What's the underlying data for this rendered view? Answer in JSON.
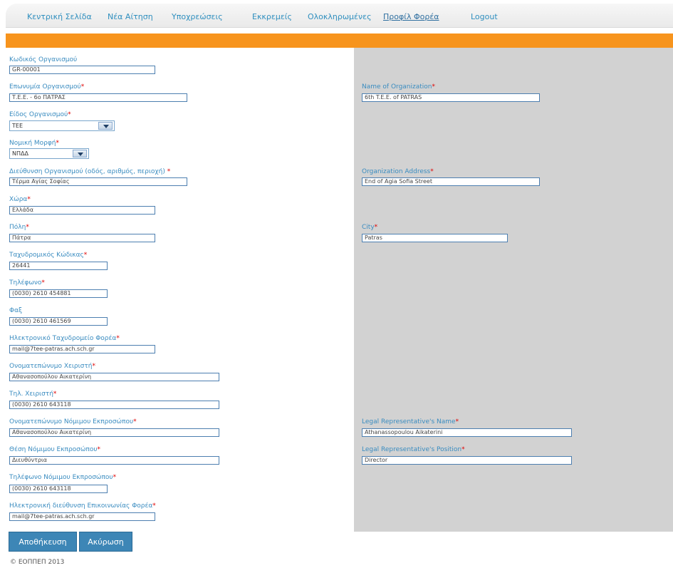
{
  "nav": {
    "home": "Κεντρική Σελίδα",
    "new_request": "Νέα Αίτηση",
    "obligations": "Υποχρεώσεις",
    "pending": "Εκκρεμείς",
    "completed": "Ολοκληρωμένες",
    "profile": "Προφίλ Φορέα",
    "logout": "Logout"
  },
  "form": {
    "org_code": {
      "label": "Κωδικός Οργανισμού",
      "value": "GR-00001"
    },
    "org_name": {
      "label": "Επωνυμία Οργανισμού",
      "required": "*",
      "value": "Τ.Ε.Ε. - 6ο ΠΑΤΡΑΣ"
    },
    "org_type": {
      "label": "Είδος Οργανισμού",
      "required": "*",
      "value": "ΤΕΕ"
    },
    "legal_form": {
      "label": "Νομική Μορφή",
      "required": "*",
      "value": "ΝΠΔΔ"
    },
    "address": {
      "label": "Διεύθυνση Οργανισμού (οδός, αριθμός, περιοχή)",
      "required": " *",
      "value": "Τέρμα Αγίας Σοφίας"
    },
    "country": {
      "label": "Χώρα",
      "required": "*",
      "value": "Ελλάδα"
    },
    "city": {
      "label": "Πόλη",
      "required": "*",
      "value": "Πάτρα"
    },
    "postal_code": {
      "label": "Ταχυδρομικός Κώδικας",
      "required": "*",
      "value": "26441"
    },
    "phone": {
      "label": "Τηλέφωνο",
      "required": "*",
      "value": "(0030) 2610 454881"
    },
    "fax": {
      "label": "Φαξ",
      "value": "(0030) 2610 461569"
    },
    "email": {
      "label": "Ηλεκτρονικό Ταχυδρομείο Φορέα",
      "required": "*",
      "value": "mail@7tee-patras.ach.sch.gr"
    },
    "handler_name": {
      "label": "Ονοματεπώνυμο Χειριστή",
      "required": "*",
      "value": "Αθανασοπούλου Αικατερίνη"
    },
    "handler_phone": {
      "label": "Τηλ. Χειριστή",
      "required": "*",
      "value": "(0030) 2610 643118"
    },
    "rep_name": {
      "label": "Ονοματεπώνυμο Νόμιμου Εκπροσώπου",
      "required": "*",
      "value": "Αθανασοπούλου Αικατερίνη"
    },
    "rep_position": {
      "label": "Θέση Νόμιμου Εκπροσώπου",
      "required": "*",
      "value": "Διευθύντρια"
    },
    "rep_phone": {
      "label": "Τηλέφωνο Νόμιμου Εκπροσώπου",
      "required": "*",
      "value": "(0030) 2610 643118"
    },
    "contact_email": {
      "label": "Ηλεκτρονική διεύθυνση Επικοινωνίας Φορέα",
      "required": "*",
      "value": "mail@7tee-patras.ach.sch.gr"
    }
  },
  "form_en": {
    "org_name": {
      "label": "Name of Organization",
      "required": "*",
      "value": "6th T.E.E. of PATRAS"
    },
    "address": {
      "label": "Organization Address",
      "required": "*",
      "value": "End of Agia Sofia Street"
    },
    "city": {
      "label": "City",
      "required": "*",
      "value": "Patras"
    },
    "rep_name": {
      "label": "Legal Representative's Name",
      "required": "*",
      "value": "Athanassopoulou Aikaterini"
    },
    "rep_position": {
      "label": "Legal Representative's Position",
      "required": "*",
      "value": "Director"
    }
  },
  "buttons": {
    "save": "Αποθήκευση",
    "cancel": "Ακύρωση"
  },
  "footer": "© ΕΟΠΠΕΠ 2013",
  "colors": {
    "accent_bar": "#f7941d",
    "link": "#3a8cc0",
    "button": "#3d86b6"
  }
}
